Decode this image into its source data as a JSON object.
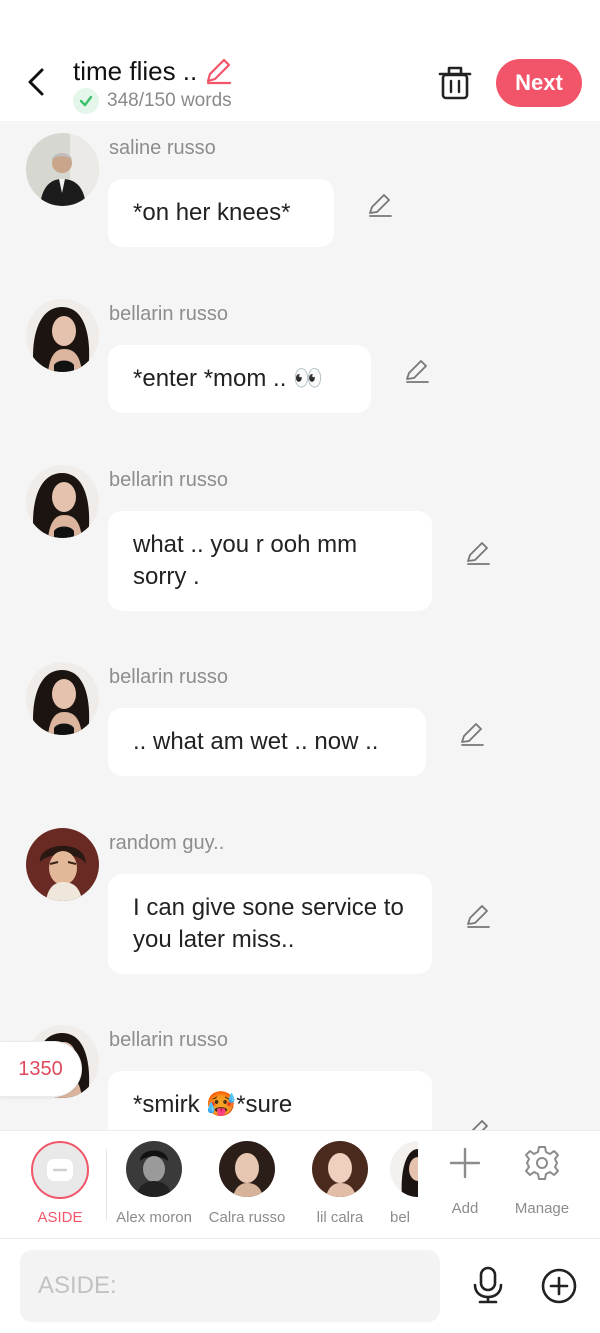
{
  "header": {
    "title": "time flies ..",
    "word_count": "348/150 words",
    "next_label": "Next"
  },
  "messages": [
    {
      "sender": "saline russo",
      "text": "*on her knees*",
      "avatar": "older man in suit"
    },
    {
      "sender": "bellarin russo",
      "text": "*enter *mom .. 👀",
      "avatar": "dark-haired woman"
    },
    {
      "sender": "bellarin russo",
      "text": "what .. you r ooh mm sorry .",
      "avatar": "dark-haired woman"
    },
    {
      "sender": "bellarin russo",
      "text": ".. what am wet .. now ..",
      "avatar": "dark-haired woman"
    },
    {
      "sender": "random guy..",
      "text": "I can give sone service to you later miss..",
      "avatar": "anime man"
    },
    {
      "sender": "bellarin russo",
      "text": "*smirk 🥵*sure",
      "avatar": "dark-haired woman"
    }
  ],
  "counter": "1350",
  "characters": [
    {
      "label": "ASIDE"
    },
    {
      "label": "Alex moron"
    },
    {
      "label": "Calra  russo"
    },
    {
      "label": "lil calra"
    },
    {
      "label": "bel"
    },
    {
      "label": "Add"
    },
    {
      "label": "Manage"
    }
  ],
  "input": {
    "placeholder": "ASIDE:"
  },
  "colors": {
    "accent": "#f25569",
    "success": "#3cc06b",
    "chat_background": "#f5f5f5"
  },
  "icons": [
    "back-arrow-icon",
    "pencil-icon",
    "check-icon",
    "trash-icon",
    "microphone-icon",
    "plus-circle-icon",
    "gear-icon"
  ]
}
